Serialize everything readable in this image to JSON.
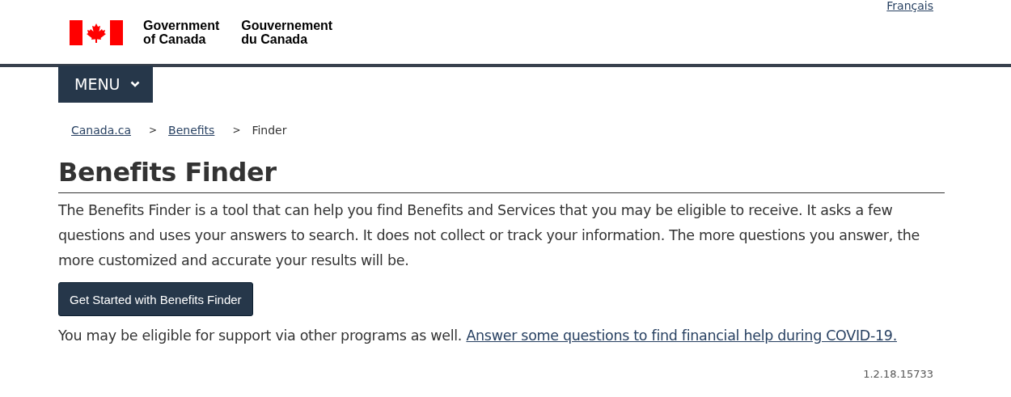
{
  "language_link": "Français",
  "logo": {
    "english": [
      "Government",
      "of Canada"
    ],
    "french": [
      "Gouvernement",
      "du Canada"
    ]
  },
  "menu_button": "MENU",
  "breadcrumbs": [
    {
      "label": "Canada.ca",
      "link": true
    },
    {
      "separator": ">",
      "label": "Benefits",
      "link": true
    },
    {
      "separator": ">",
      "label": "Finder",
      "link": false
    }
  ],
  "title": "Benefits Finder",
  "intro": "The Benefits Finder is a tool that can help you find Benefits and Services that you may be eligible to receive. It asks a few questions and uses your answers to search. It does not collect or track your information. The more questions you answer, the more customized and accurate your results will be.",
  "start_button": "Get Started with Benefits Finder",
  "note": {
    "text": "You may be eligible for support via other programs as well.",
    "link": "Answer some questions to find financial help during COVID-19."
  },
  "version": "1.2.18.15733"
}
